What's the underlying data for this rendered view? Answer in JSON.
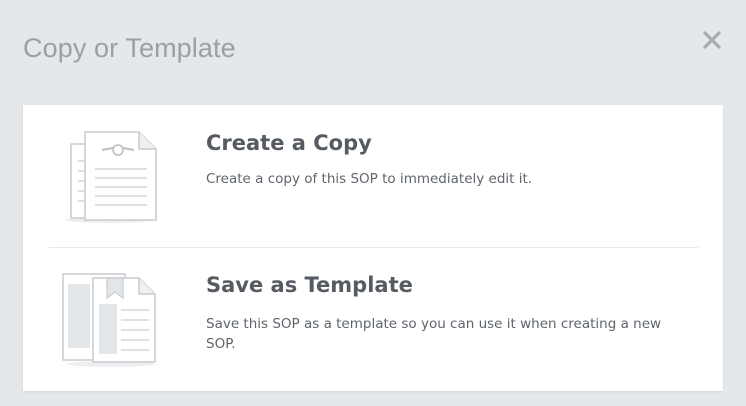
{
  "dialog": {
    "title": "Copy or Template",
    "close_icon": "close-icon"
  },
  "options": [
    {
      "title": "Create a Copy",
      "description": "Create a copy of this SOP to immediately edit it.",
      "icon": "copy-document-icon"
    },
    {
      "title": "Save as Template",
      "description": "Save this SOP as a template so you can use it when creating a new SOP.",
      "icon": "template-documents-icon"
    }
  ],
  "colors": {
    "backdrop": "#e5e8ea",
    "card": "#ffffff",
    "title_text": "#9aa0a6",
    "heading_text": "#555b61",
    "body_text": "#5f656b",
    "icon_stroke": "#c7cbcf",
    "icon_fill": "#e3e6e9"
  }
}
